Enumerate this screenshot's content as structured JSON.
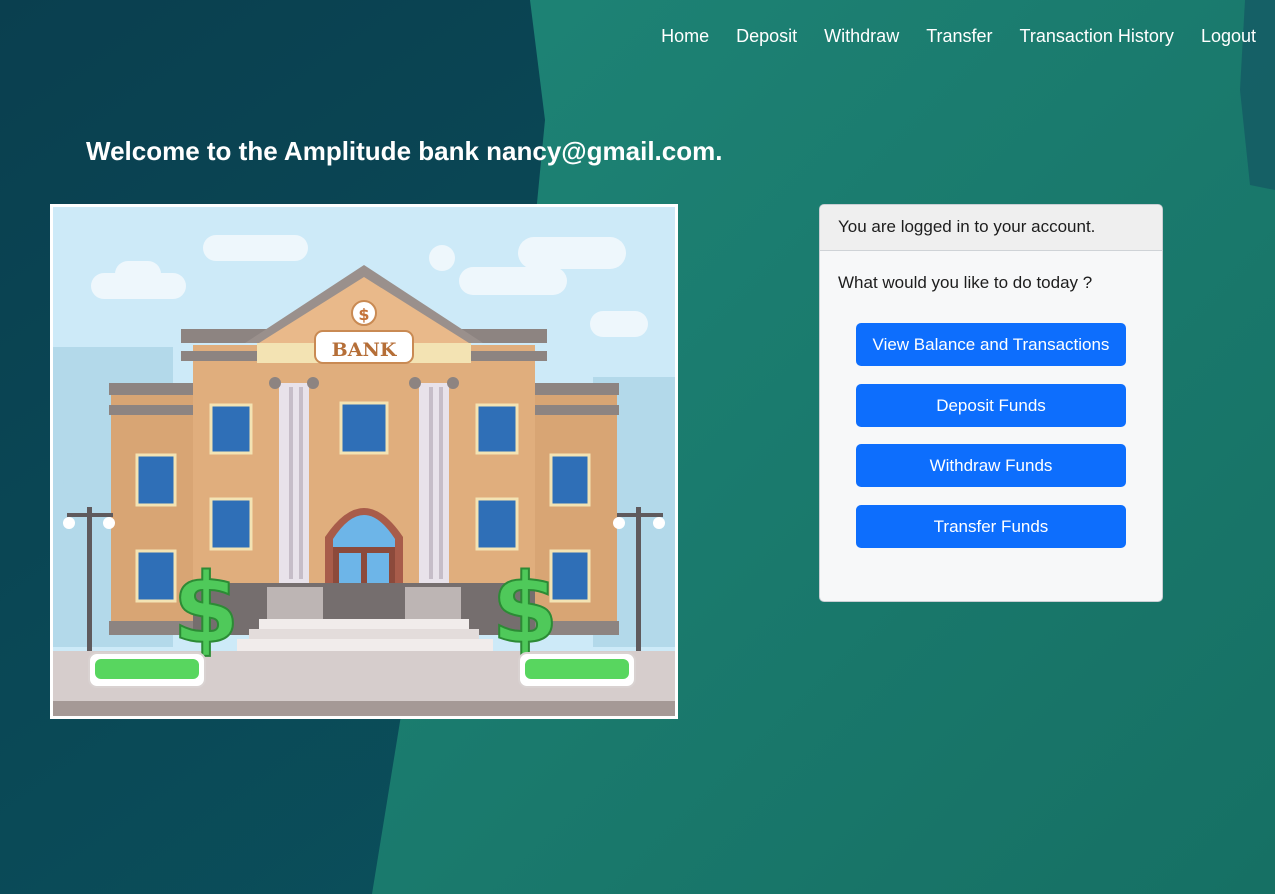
{
  "nav": {
    "items": [
      "Home",
      "Deposit",
      "Withdraw",
      "Transfer",
      "Transaction History",
      "Logout"
    ]
  },
  "welcome": "Welcome to the Amplitude bank nancy@gmail.com.",
  "illustration": {
    "sign_text": "BANK",
    "coin_symbol": "$"
  },
  "card": {
    "header": "You are logged in to your account.",
    "question": "What would you like to do today ?",
    "buttons": [
      "View Balance and Transactions",
      "Deposit Funds",
      "Withdraw Funds",
      "Transfer Funds"
    ]
  },
  "colors": {
    "primary_button": "#0d6efd",
    "background_dark": "#0b4d5a",
    "background_teal": "#1c7d72"
  }
}
